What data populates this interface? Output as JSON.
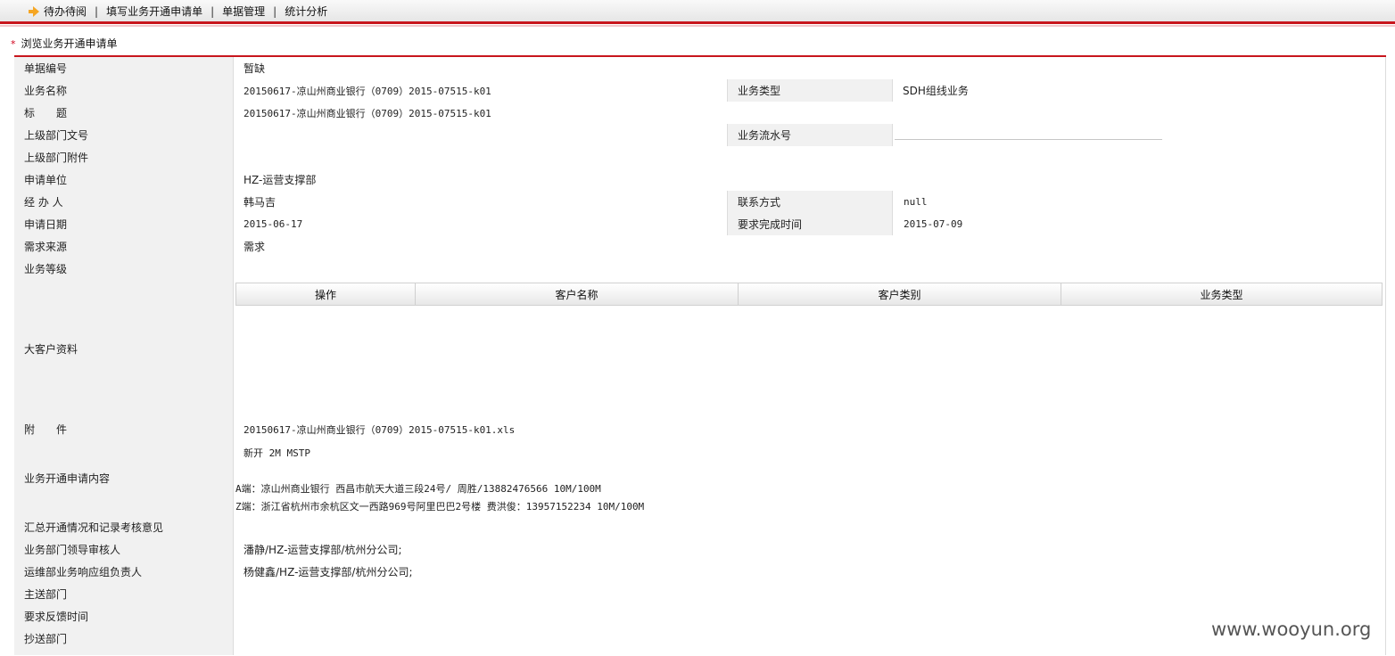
{
  "nav": {
    "items": [
      "待办待阅",
      "填写业务开通申请单",
      "单据管理",
      "统计分析"
    ],
    "separator": "|",
    "arrow_icon": "arrow-right-icon",
    "arrow_color": "#f5a623"
  },
  "section": {
    "star": "*",
    "title": "浏览业务开通申请单",
    "accent": "#c8161d"
  },
  "form": {
    "doc_no": {
      "label": "单据编号",
      "value": "暂缺"
    },
    "biz_name": {
      "label": "业务名称",
      "value": "20150617-凉山州商业银行（0709）2015-07515-k01"
    },
    "biz_type": {
      "label": "业务类型",
      "value": "SDH组线业务"
    },
    "title": {
      "label": "标　　题",
      "value": "20150617-凉山州商业银行（0709）2015-07515-k01"
    },
    "upper_doc_no": {
      "label": "上级部门文号",
      "value": ""
    },
    "serial_no": {
      "label": "业务流水号",
      "value": ""
    },
    "upper_attach": {
      "label": "上级部门附件",
      "value": ""
    },
    "applicant_unit": {
      "label": "申请单位",
      "value": "HZ-运营支撑部"
    },
    "handler": {
      "label": "经 办 人",
      "value": "韩马吉"
    },
    "contact": {
      "label": "联系方式",
      "value": "null"
    },
    "apply_date": {
      "label": "申请日期",
      "value": "2015-06-17"
    },
    "due_date": {
      "label": "要求完成时间",
      "value": "2015-07-09"
    },
    "demand_source": {
      "label": "需求来源",
      "value": "需求"
    },
    "biz_level": {
      "label": "业务等级",
      "value": ""
    },
    "customer": {
      "label": "大客户资料",
      "headers": [
        "操作",
        "客户名称",
        "客户类别",
        "业务类型"
      ]
    },
    "attachment": {
      "label": "附　　件",
      "value": "20150617-凉山州商业银行（0709）2015-07515-k01.xls"
    },
    "content": {
      "label": "业务开通申请内容",
      "line1": "新开 2M MSTP",
      "line2": "A端：凉山州商业银行 西昌市航天大道三段24号/ 周胜/13882476566 10M/100M",
      "line3": "Z端：浙江省杭州市余杭区文一西路969号阿里巴巴2号楼 费洪俊：13957152234 10M/100M"
    },
    "summary": {
      "label": "汇总开通情况和记录考核意见",
      "value": ""
    },
    "reviewer": {
      "label": "业务部门领导审核人",
      "value": "潘静/HZ-运营支撑部/杭州分公司;"
    },
    "ops_owner": {
      "label": "运维部业务响应组负责人",
      "value": "杨健鑫/HZ-运营支撑部/杭州分公司;"
    },
    "main_dept": {
      "label": "主送部门",
      "value": ""
    },
    "feedback_time": {
      "label": "要求反馈时间",
      "value": ""
    },
    "cc_dept": {
      "label": "抄送部门",
      "value": ""
    }
  },
  "watermark": "www.wooyun.org"
}
